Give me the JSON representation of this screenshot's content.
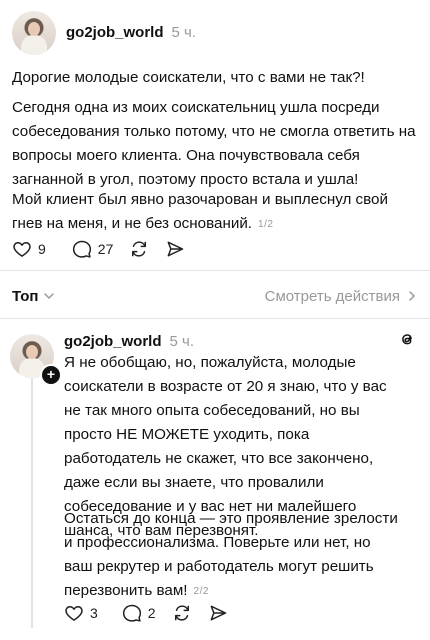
{
  "post1": {
    "username": "go2job_world",
    "time": "5 ч.",
    "paragraphs": [
      "Дорогие молодые соискатели, что с вами не так?!",
      "Сегодня одна из моих соискательниц ушла посреди собеседования только потому, что не смогла ответить на вопросы моего клиента. Она почувствовала себя загнанной в угол, поэтому просто встала и ушла!",
      "Мой клиент был явно разочарован и выплеснул свой гнев на меня, и не без оснований."
    ],
    "page_counter": "1/2",
    "likes": "9",
    "comments": "27"
  },
  "sort": {
    "label": "Топ",
    "view_actions": "Смотреть действия"
  },
  "post2": {
    "username": "go2job_world",
    "time": "5 ч.",
    "paragraphs": [
      "Я не обобщаю, но, пожалуйста, молодые соискатели в возрасте от 20 я знаю, что у вас не так много опыта собеседований, но вы просто НЕ МОЖЕТЕ уходить, пока работодатель не скажет, что все закончено, даже если вы знаете, что провалили собеседование и у вас нет ни малейшего шанса, что вам перезвонят.",
      "Остаться до конца — это проявление зрелости и профессионализма. Поверьте или нет, но ваш рекрутер и работодатель могут решить перезвонить вам!"
    ],
    "page_counter": "2/2",
    "likes": "3",
    "comments": "2"
  },
  "icons": {
    "like": "heart-icon",
    "comment": "comment-bubble-icon",
    "repost": "repost-icon",
    "share": "send-icon",
    "sort": "chevron-down-icon",
    "view": "chevron-right-icon",
    "threads": "threads-logo-icon",
    "follow": "plus-icon"
  }
}
